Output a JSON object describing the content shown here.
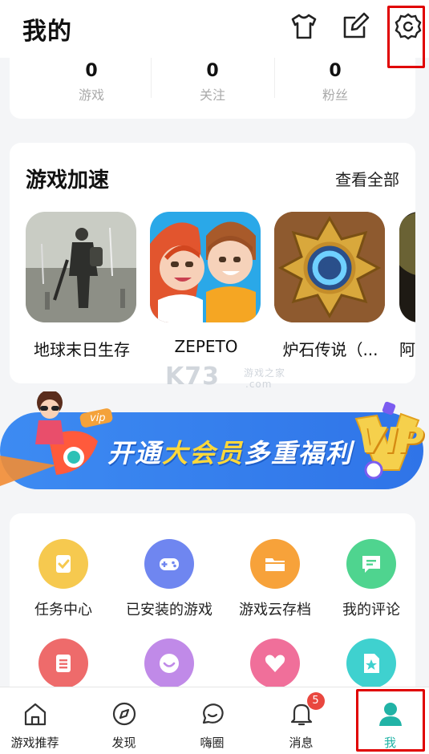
{
  "header": {
    "title": "我的",
    "icons": [
      "tshirt-icon",
      "edit-icon",
      "settings-icon"
    ]
  },
  "stats": [
    {
      "value": "0",
      "label": "游戏"
    },
    {
      "value": "0",
      "label": "关注"
    },
    {
      "value": "0",
      "label": "粉丝"
    }
  ],
  "accel": {
    "title": "游戏加速",
    "view_all": "查看全部",
    "games": [
      {
        "name": "地球末日生存"
      },
      {
        "name": "ZEPETO"
      },
      {
        "name": "炉石传说（..."
      },
      {
        "name": "阿"
      }
    ]
  },
  "watermark": {
    "main": "K73",
    "sub": "游戏之家",
    "domain": ".com"
  },
  "banner": {
    "vip_tag": "vip",
    "part1": "开通",
    "part2": "大会员",
    "part3": "多重福利",
    "vip_logo": "VIP"
  },
  "features": [
    {
      "label": "任务中心",
      "color": "#f6c94f",
      "icon": "task-icon"
    },
    {
      "label": "已安装的游戏",
      "color": "#6f86f0",
      "icon": "gamepad-icon"
    },
    {
      "label": "游戏云存档",
      "color": "#f7a23a",
      "icon": "folder-icon"
    },
    {
      "label": "我的评论",
      "color": "#4fd48f",
      "icon": "comment-icon"
    },
    {
      "label": "",
      "color": "#ee6b6b",
      "icon": "list-icon"
    },
    {
      "label": "",
      "color": "#c08ae8",
      "icon": "chat-icon"
    },
    {
      "label": "",
      "color": "#f06f9a",
      "icon": "heart-icon"
    },
    {
      "label": "",
      "color": "#3fd1cf",
      "icon": "star-doc-icon"
    }
  ],
  "nav": [
    {
      "label": "游戏推荐",
      "icon": "home-icon"
    },
    {
      "label": "发现",
      "icon": "compass-icon"
    },
    {
      "label": "嗨圈",
      "icon": "bubble-icon"
    },
    {
      "label": "消息",
      "icon": "bell-icon",
      "badge": "5"
    },
    {
      "label": "我",
      "icon": "user-icon",
      "active": true
    }
  ],
  "colors": {
    "accent": "#21b3a6",
    "badge": "#e9473f",
    "highlight": "#e00000"
  }
}
